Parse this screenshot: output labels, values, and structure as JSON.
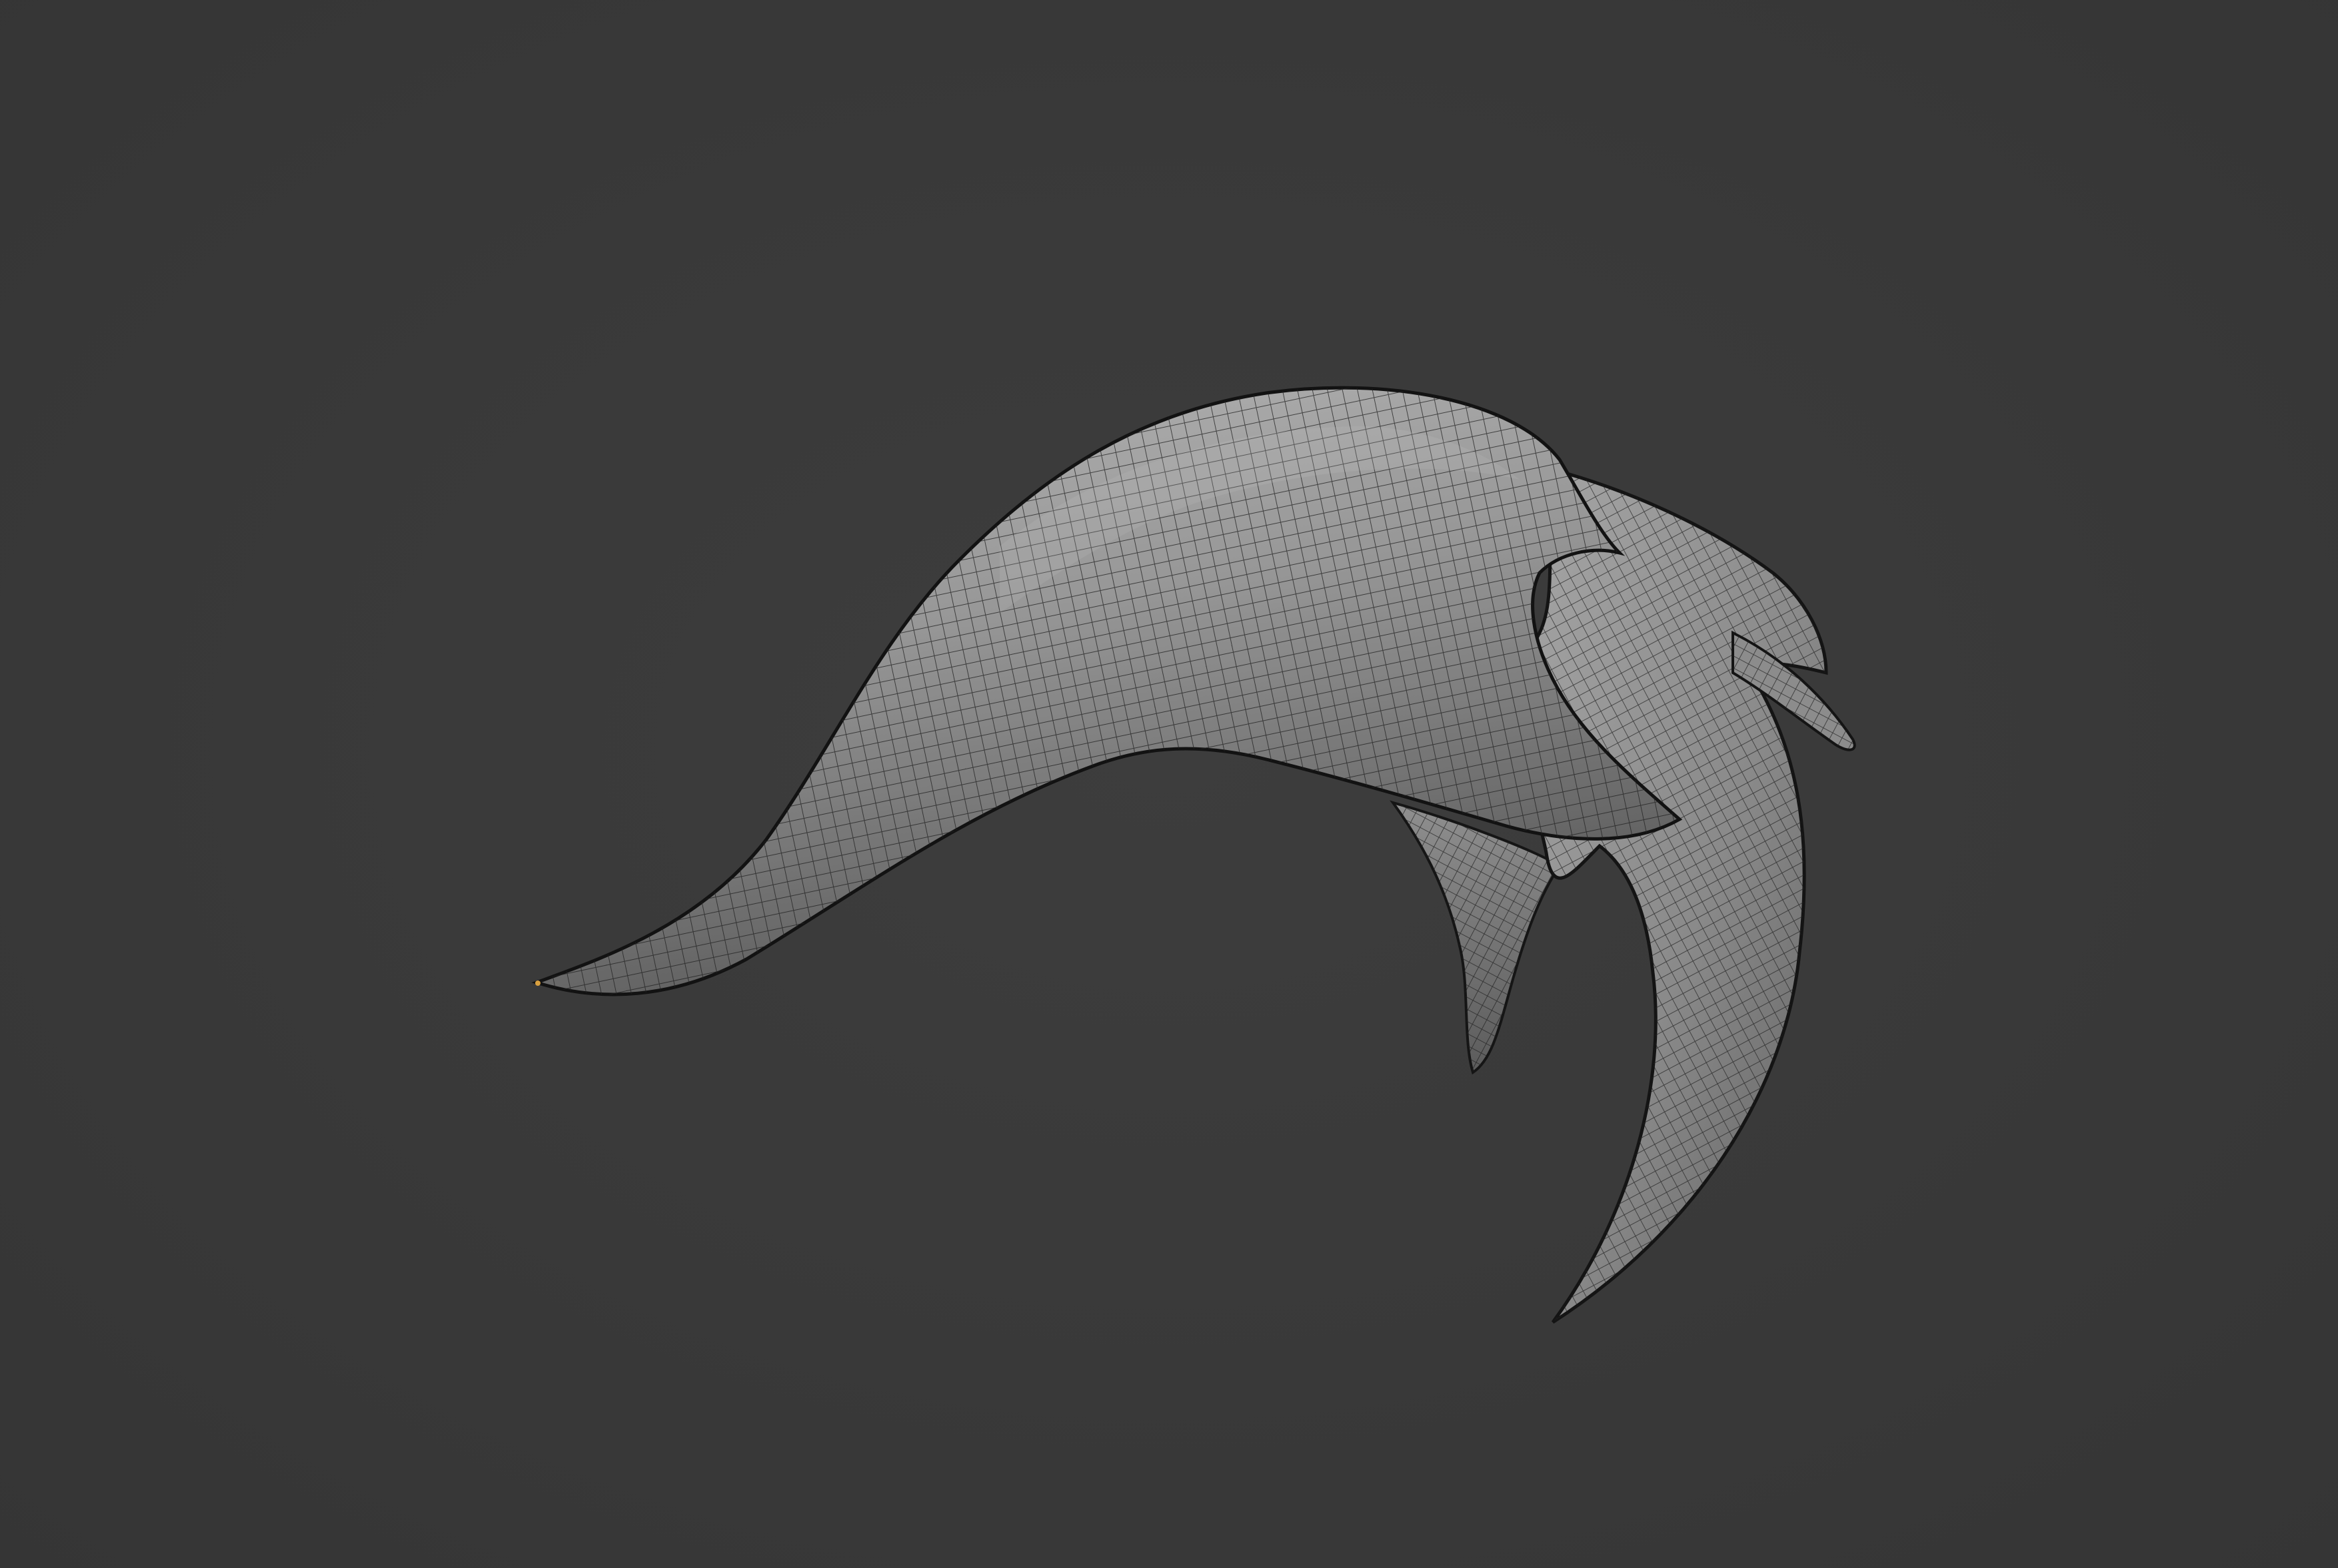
{
  "viewport": {
    "background_color": "#3a3a3a",
    "view_mode": "wireframe-overlay",
    "object": {
      "kind": "subdivided curved horn mesh",
      "surface_color": "#8e8e8e",
      "shadow_color": "#5a5a5a",
      "highlight_color": "#a9a9a9",
      "wire_color": "#1e1e1e",
      "outline_color": "#141414"
    }
  }
}
